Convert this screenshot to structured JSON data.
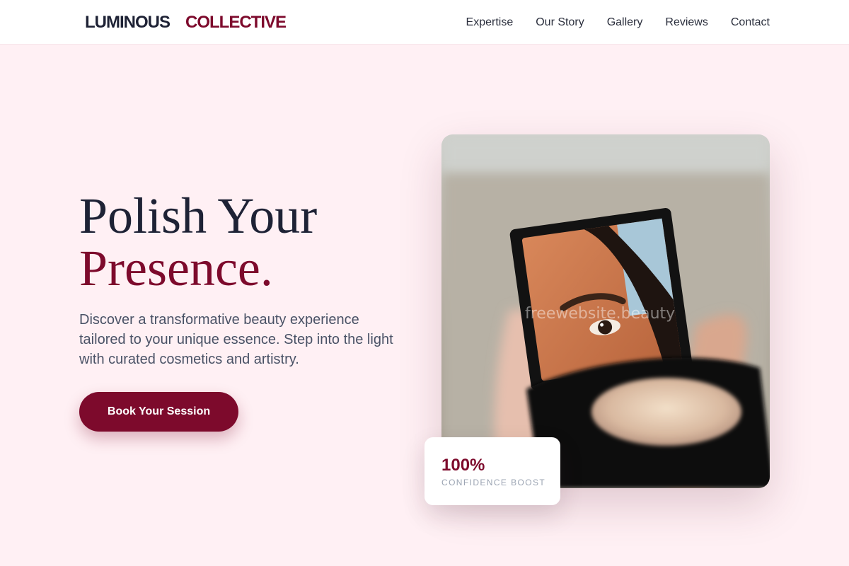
{
  "brand": {
    "word1": "LUMINOUS",
    "word2": "COLLECTIVE"
  },
  "nav": {
    "items": [
      "Expertise",
      "Our Story",
      "Gallery",
      "Reviews",
      "Contact"
    ]
  },
  "hero": {
    "title_line1": "Polish Your",
    "title_line2": "Presence.",
    "description": "Discover a transformative beauty experience tailored to your unique essence. Step into the light with curated cosmetics and artistry.",
    "cta_label": "Book Your Session"
  },
  "photo": {
    "subject": "hand holding compact mirror reflecting an eye",
    "watermark": "freewebsite.beauty"
  },
  "stat": {
    "value": "100%",
    "label": "CONFIDENCE BOOST"
  },
  "colors": {
    "background": "#fff0f4",
    "brand_dark": "#1e2235",
    "accent": "#7d0a2c",
    "text_muted": "#4a5266",
    "label_gray": "#9aa3b2"
  }
}
